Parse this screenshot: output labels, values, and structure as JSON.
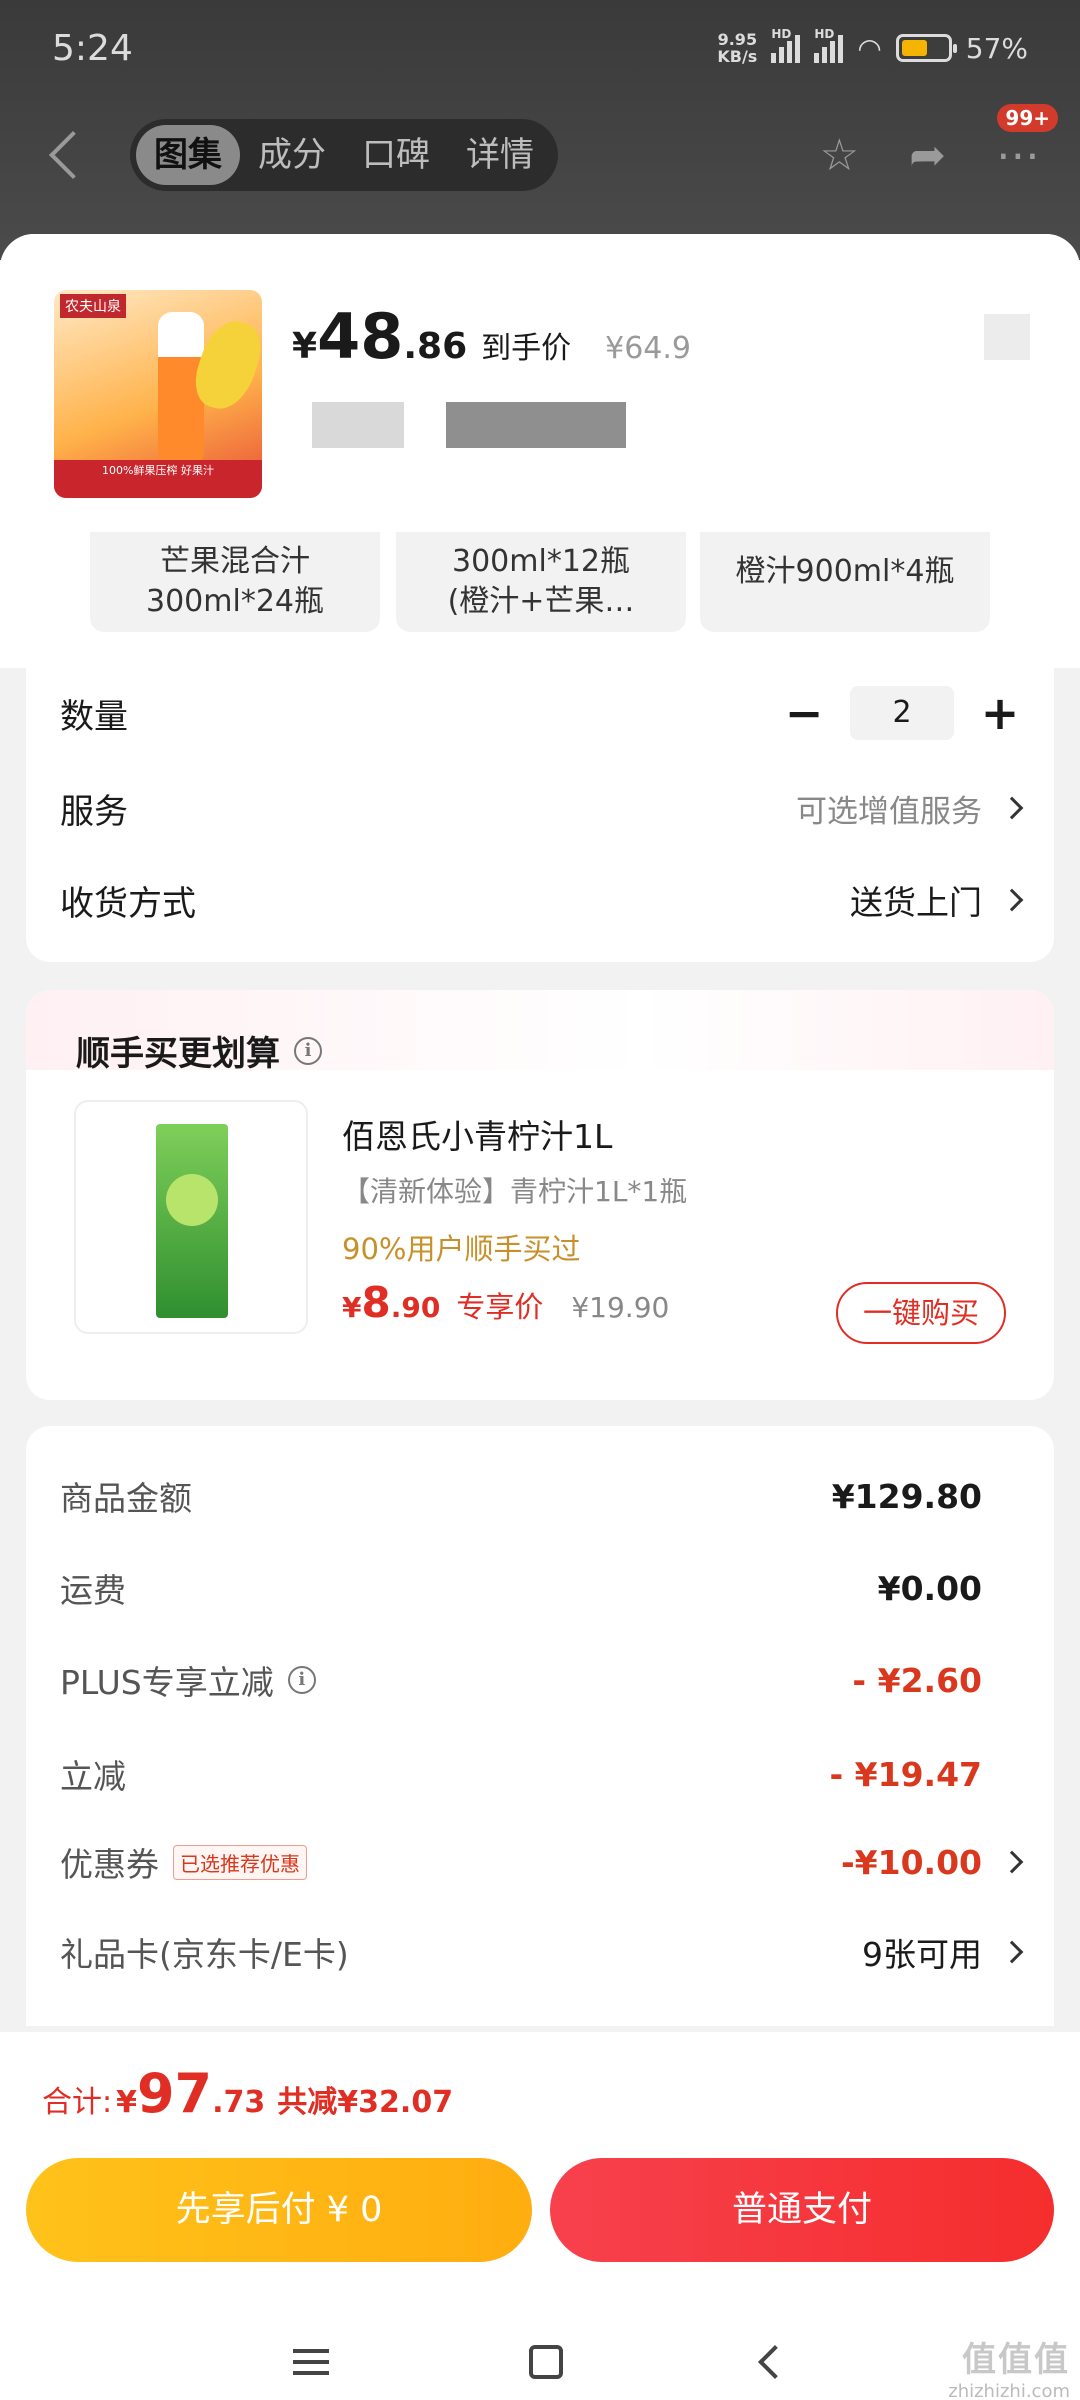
{
  "status_bar": {
    "time": "5:24",
    "net_speed_top": "9.95",
    "net_speed_bottom": "KB/s",
    "hd": "HD",
    "battery": "57%",
    "battery_level": 0.57
  },
  "top_nav": {
    "tabs": [
      "图集",
      "成分",
      "口碑",
      "详情"
    ],
    "active_tab": 0,
    "icons": [
      "star-icon",
      "share-icon",
      "more-icon"
    ],
    "badge": "99+"
  },
  "product": {
    "thumb_logo": "农夫山泉",
    "thumb_caption": "100%鲜果压榨 好果汁",
    "price_symbol": "¥",
    "price_int": "48",
    "price_dec": ".86",
    "price_tag": "到手价",
    "original_price": "¥64.9"
  },
  "specs": [
    {
      "line1": "芒果混合汁",
      "line2": "300ml*24瓶"
    },
    {
      "line1": "300ml*12瓶",
      "line2": "(橙汁+芒果…"
    },
    {
      "line1": "橙汁900ml*4瓶",
      "line2": ""
    }
  ],
  "options": {
    "quantity_label": "数量",
    "quantity": "2",
    "minus": "−",
    "plus": "+",
    "service_label": "服务",
    "service_value": "可选增值服务",
    "delivery_label": "收货方式",
    "delivery_value": "送货上门"
  },
  "cross_sell": {
    "title": "顺手买更划算",
    "info_icon": "i",
    "name": "佰恩氏小青柠汁1L",
    "spec": "【清新体验】青柠汁1L*1瓶",
    "note": "90%用户顺手买过",
    "price_symbol": "¥",
    "price_int": "8",
    "price_dec": ".90",
    "price_tag": "专享价",
    "original_price": "¥19.90",
    "button": "一键购买"
  },
  "summary": {
    "rows": [
      {
        "label": "商品金额",
        "value": "¥129.80"
      },
      {
        "label": "运费",
        "value": "¥0.00"
      },
      {
        "label": "PLUS专享立减",
        "value": "- ¥2.60"
      },
      {
        "label": "立减",
        "value": "- ¥19.47"
      },
      {
        "label": "优惠券",
        "tag": "已选推荐优惠",
        "value": "-¥10.00"
      },
      {
        "label": "礼品卡(京东卡/E卡)",
        "value": "9张可用"
      }
    ]
  },
  "footer": {
    "total_label": "合计:",
    "total_symbol": "¥",
    "total_int": "97",
    "total_dec": ".73",
    "savings": "共减¥32.07",
    "pay_later": "先享后付 ¥ 0",
    "pay_normal": "普通支付"
  },
  "watermark": {
    "big": "值值值",
    "small": "zhizhizhi.com"
  },
  "colors": {
    "accent_red": "#e02e24",
    "pay_later_yellow": "#ffb81a",
    "note_gold": "#c8902a"
  }
}
